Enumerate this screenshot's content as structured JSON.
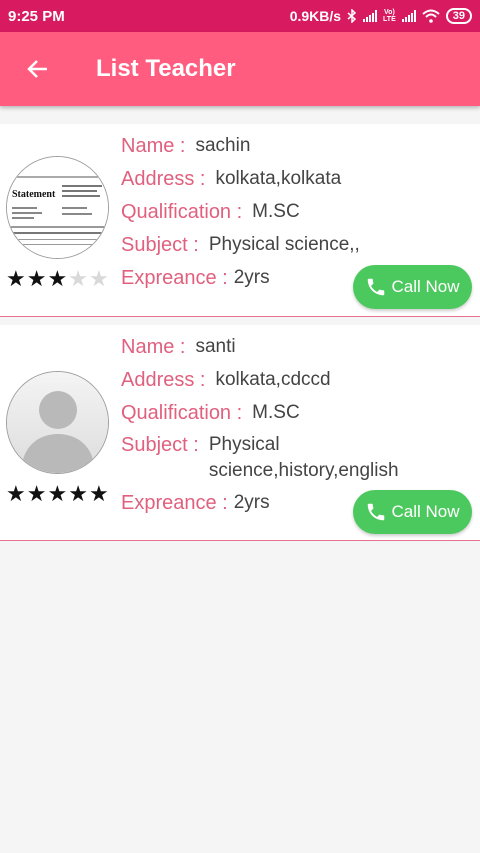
{
  "status_bar": {
    "time": "9:25 PM",
    "speed": "0.9KB/s",
    "lte_top": "Vo)",
    "lte_bottom": "LTE",
    "battery": "39"
  },
  "app_bar": {
    "title": "List Teacher"
  },
  "labels": {
    "name": "Name :",
    "address": "Address :",
    "qualification": "Qualification :",
    "subject": "Subject :",
    "experience": "Expreance :"
  },
  "teachers": [
    {
      "name": "sachin",
      "address": "kolkata,kolkata",
      "qualification": "M.SC",
      "subject": "Physical science,,",
      "experience": "2yrs",
      "rating": 3,
      "call_label": "Call Now",
      "avatar_text": "Statement"
    },
    {
      "name": "santi",
      "address": "kolkata,cdccd",
      "qualification": "M.SC",
      "subject": "Physical science,history,english",
      "experience": "2yrs",
      "rating": 5,
      "call_label": "Call Now"
    }
  ]
}
